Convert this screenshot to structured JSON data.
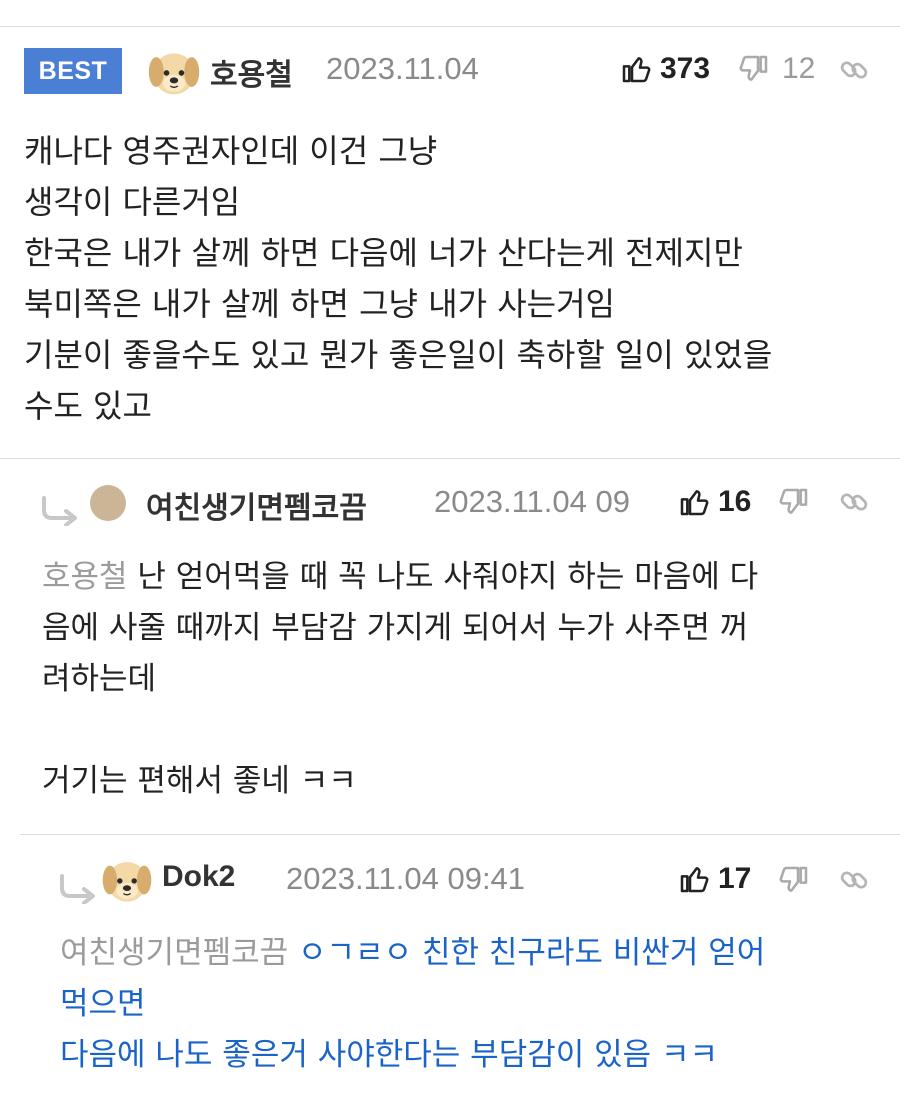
{
  "comments": [
    {
      "badge": "BEST",
      "nickname": "호용철",
      "date": "2023.11.04",
      "upvotes": "373",
      "downvotes": "12",
      "lines": [
        "캐나다 영주권자인데 이건 그냥",
        "생각이 다른거임",
        "한국은 내가 살께 하면 다음에 너가 산다는게 전제지만",
        "북미쪽은 내가 살께 하면 그냥 내가 사는거임",
        "기분이 좋을수도 있고 뭔가 좋은일이 축하할 일이 있었을",
        "수도 있고"
      ]
    },
    {
      "nickname": "여친생기면펨코끔",
      "date": "2023.11.04 09",
      "upvotes": "16",
      "mention": "호용철",
      "line1_after_mention": " 난 얻어먹을 때 꼭 나도 사줘야지 하는 마음에 다",
      "lines": [
        "음에 사줄 때까지 부담감 가지게 되어서 누가 사주면 꺼",
        "려하는데",
        "",
        "거기는 편해서 좋네 ㅋㅋ"
      ]
    },
    {
      "nickname": "Dok2",
      "date": "2023.11.04 09:41",
      "upvotes": "17",
      "mention": "여친생기면펨코끔",
      "line1_after_mention": " ㅇㄱㄹㅇ 친한 친구라도 비싼거 얻어",
      "lines": [
        "먹으면",
        "다음에 나도 좋은거 사야한다는 부담감이 있음 ㅋㅋ"
      ]
    }
  ],
  "icons": {
    "thumb_up": "thumbs-up-icon",
    "thumb_down": "thumbs-down-icon",
    "link": "link-icon",
    "reply": "reply-arrow-icon",
    "avatar_dog": "puppy-avatar-icon",
    "avatar_plain": "circle-avatar-icon"
  },
  "colors": {
    "best_badge": "#4a7fd4",
    "reply_text_blue": "#1a63c9",
    "mention_gray": "#9b9b9b"
  }
}
